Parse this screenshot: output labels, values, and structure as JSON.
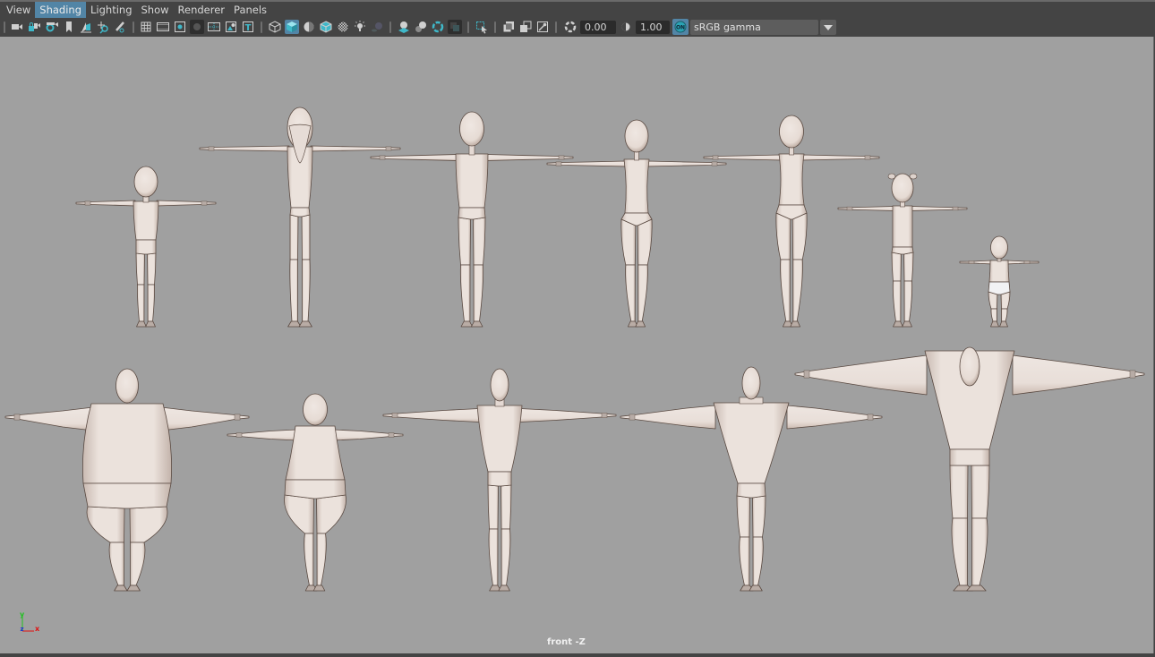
{
  "menubar": {
    "items": [
      {
        "label": "View",
        "active": false
      },
      {
        "label": "Shading",
        "active": true
      },
      {
        "label": "Lighting",
        "active": false
      },
      {
        "label": "Show",
        "active": false
      },
      {
        "label": "Renderer",
        "active": false
      },
      {
        "label": "Panels",
        "active": false
      }
    ]
  },
  "toolbar": {
    "icons": [
      "select-camera-icon",
      "lock-camera-icon",
      "camera-attributes-icon",
      "bookmark-icon",
      "image-plane-icon",
      "2d-pan-zoom-icon",
      "grease-pencil-icon",
      "grid-icon",
      "film-gate-icon",
      "resolution-gate-icon",
      "gate-mask-icon",
      "field-chart-icon",
      "safe-action-icon",
      "safe-title-icon",
      "wireframe-icon",
      "smooth-shade-icon",
      "default-material-icon",
      "wireframe-on-shaded-icon",
      "textured-icon",
      "use-all-lights-icon",
      "shadows-icon",
      "screen-space-ao-icon",
      "motion-blur-icon",
      "anti-aliasing-icon",
      "depth-of-field-icon",
      "isolate-select-icon",
      "xray-icon",
      "xray-active-components-icon",
      "xray-joints-icon",
      "exposure-icon",
      "gamma-icon",
      "color-management-toggle-icon"
    ],
    "exposure_value": "0.00",
    "gamma_value": "1.00",
    "color_mgmt_badge": "ON",
    "color_space": "sRGB gamma"
  },
  "viewport": {
    "camera_label": "front -Z",
    "axis": {
      "y": "y",
      "x": "x",
      "z": "z"
    },
    "background_color": "#a0a0a0",
    "skin_color": "#eae0da",
    "diaper_color": "#f2f2f4",
    "figures": [
      {
        "name": "boy",
        "row": 1
      },
      {
        "name": "old-man",
        "row": 1
      },
      {
        "name": "man",
        "row": 1
      },
      {
        "name": "woman",
        "row": 1
      },
      {
        "name": "tall-woman",
        "row": 1
      },
      {
        "name": "girl",
        "row": 1
      },
      {
        "name": "baby",
        "row": 1
      },
      {
        "name": "obese-man",
        "row": 2
      },
      {
        "name": "heavy-woman",
        "row": 2
      },
      {
        "name": "athletic-man",
        "row": 2
      },
      {
        "name": "muscular-man",
        "row": 2
      },
      {
        "name": "giant-bodybuilder",
        "row": 2
      }
    ]
  },
  "colors": {
    "accent": "#5285a6",
    "icon_teal": "#3fb8c9",
    "ui_bg": "#444444",
    "field_bg": "#2b2b2b"
  }
}
